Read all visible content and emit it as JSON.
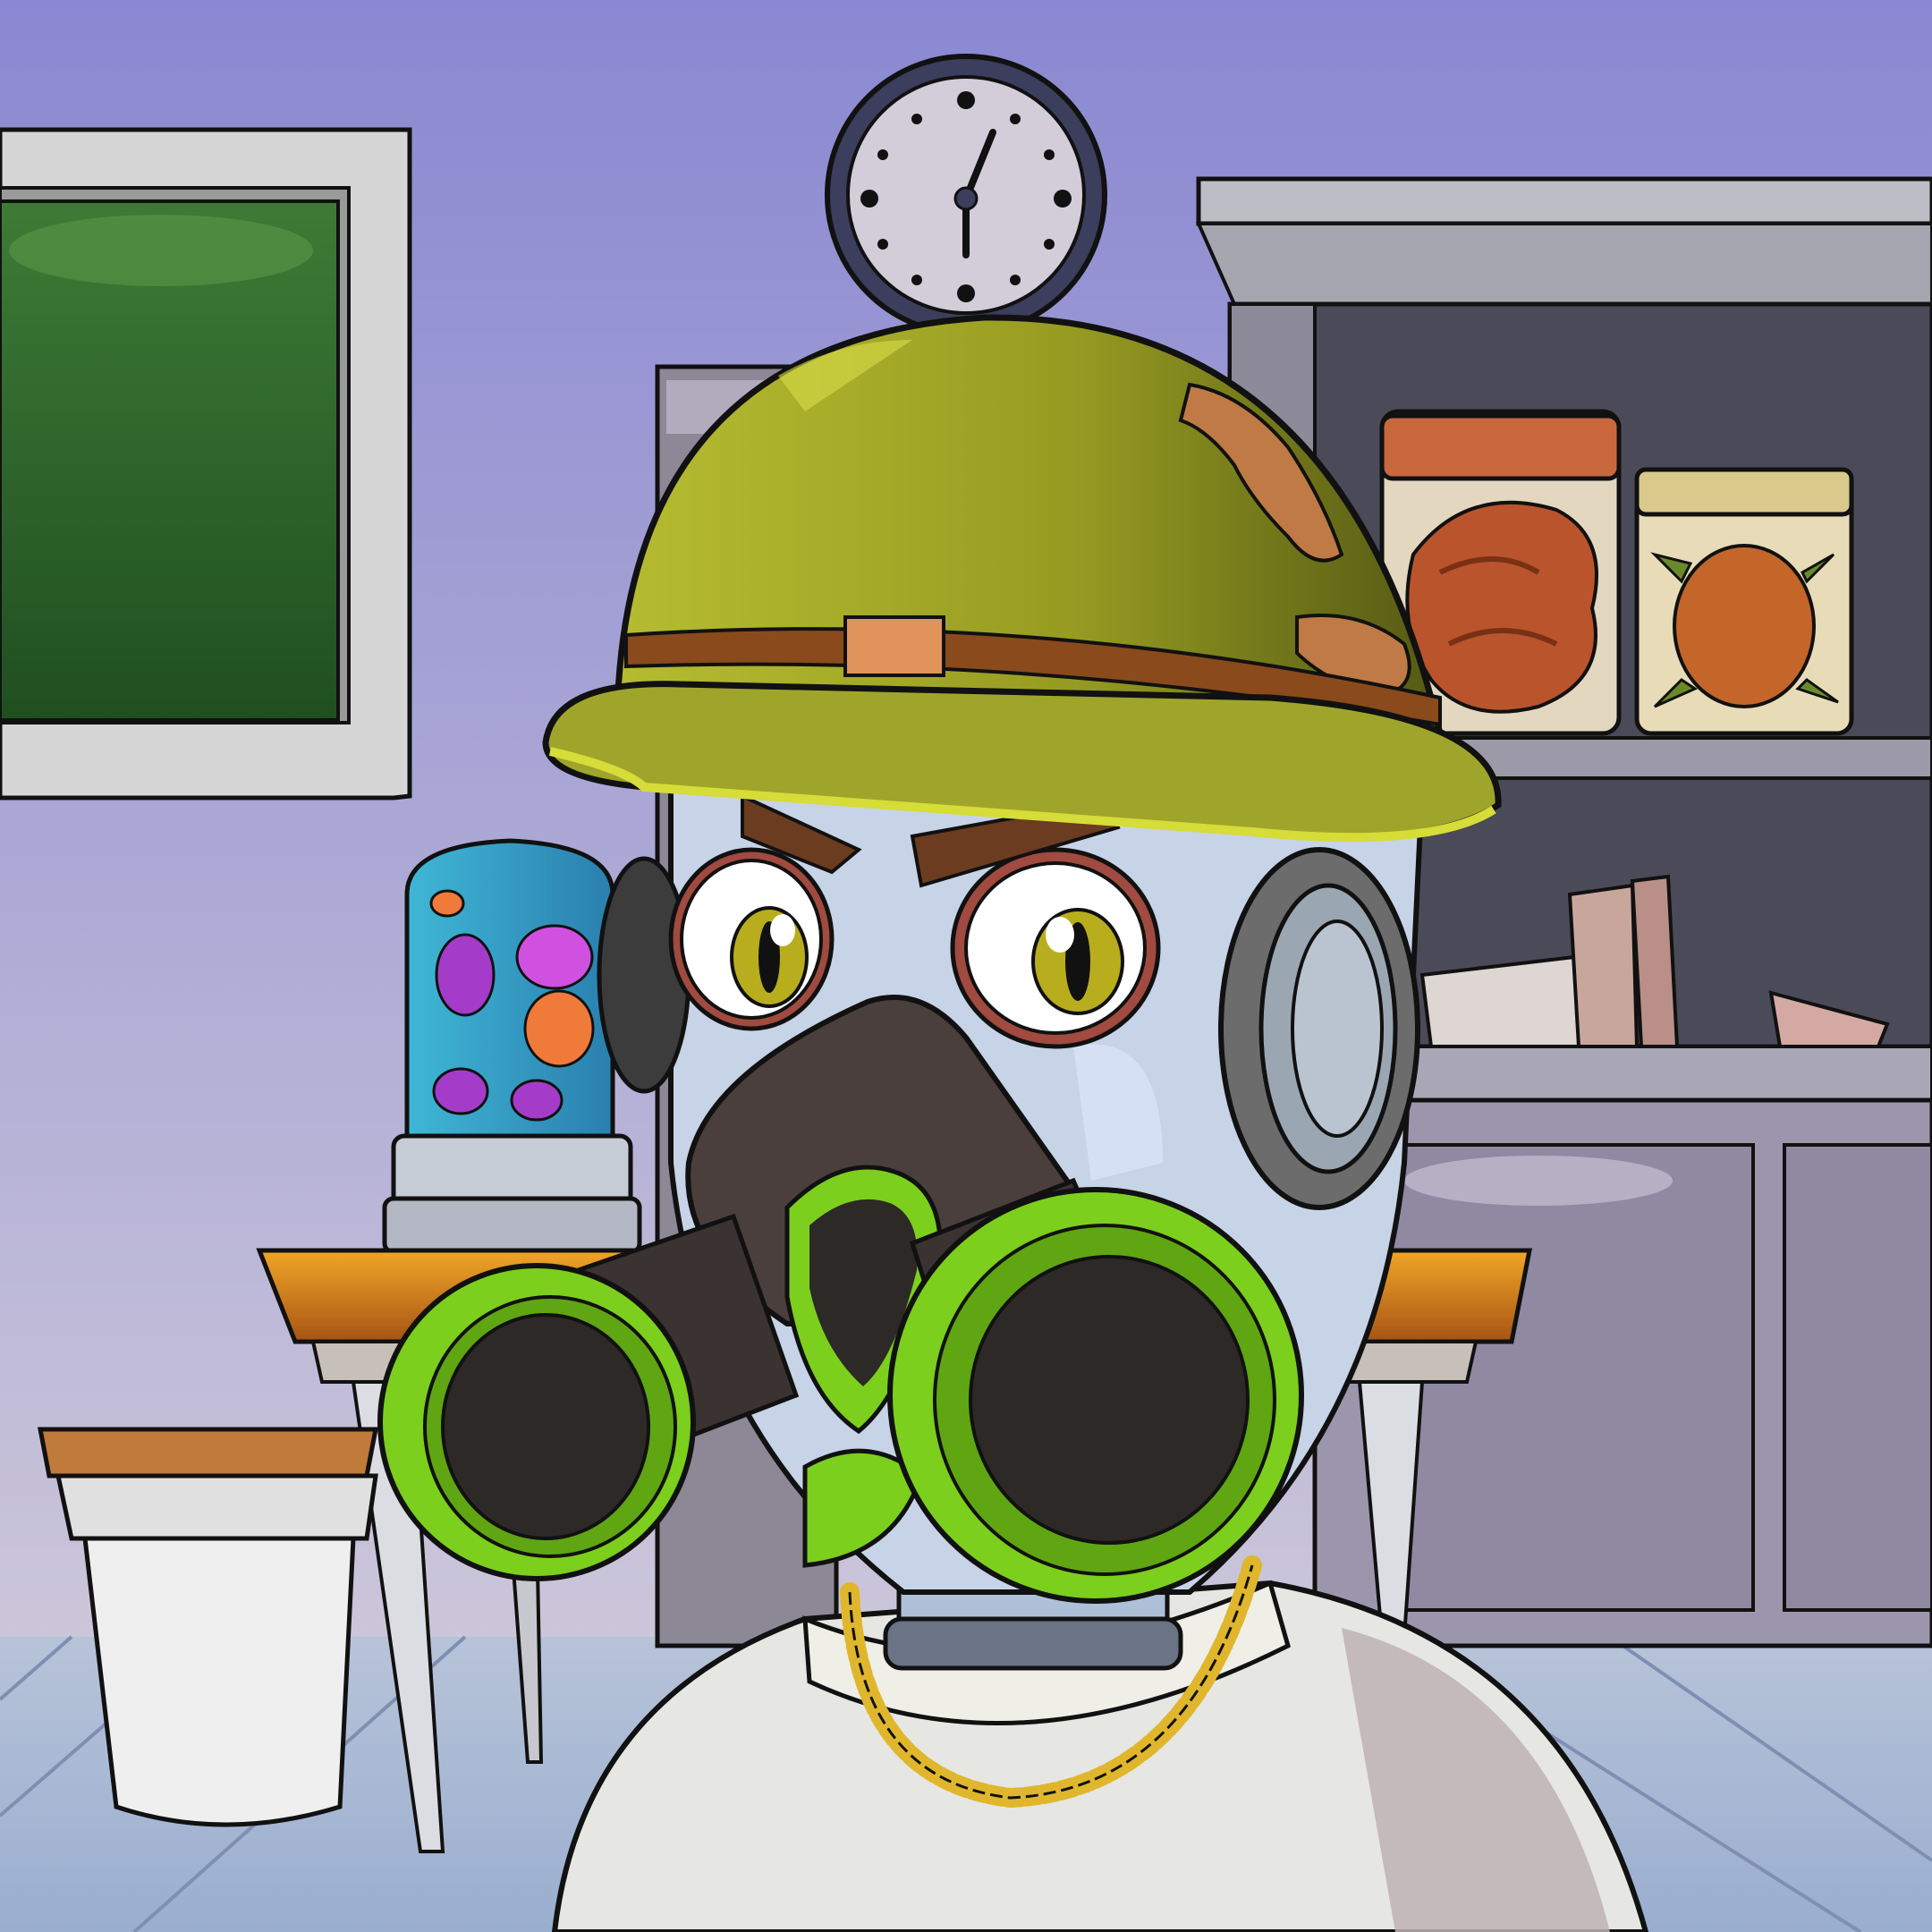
{
  "scene": {
    "kind": "illustration",
    "subject": "character-in-gas-mask-and-helmet",
    "setting": "laboratory"
  },
  "palette": {
    "wall_top": "#8d8bd0",
    "wall_bottom": "#c9c4d8",
    "floor": "#aebcd6",
    "board_frame": "#d4d4d4",
    "board_green": "#2f6a2c",
    "clock_face": "#d3cdd9",
    "clock_rim": "#3b3e5c",
    "helmet": "#9fa52a",
    "helmet_dark": "#5a5e14",
    "helmet_band": "#8a4a1c",
    "camo_spot": "#c07a45",
    "face": "#c7d3e6",
    "mask": "#4a3f3c",
    "filter_ring": "#7ccf1c",
    "filter_dark": "#2d2927",
    "eye_iris": "#b8ae1d",
    "brow": "#6b3c20",
    "shirt": "#e6e6e2",
    "chain": "#e0b62c",
    "table_top": "#d7871f",
    "cabinet": "#9c96ad",
    "shelf_back": "#4b4a58",
    "jar_specimen": "#b9542c",
    "lava_lamp": "#39a8c8",
    "blob_purple": "#a43bc9",
    "blob_orange": "#f07a3a"
  },
  "icons": {
    "clock": "wall-clock-icon",
    "helmet": "army-helmet",
    "mask": "gas-mask"
  }
}
